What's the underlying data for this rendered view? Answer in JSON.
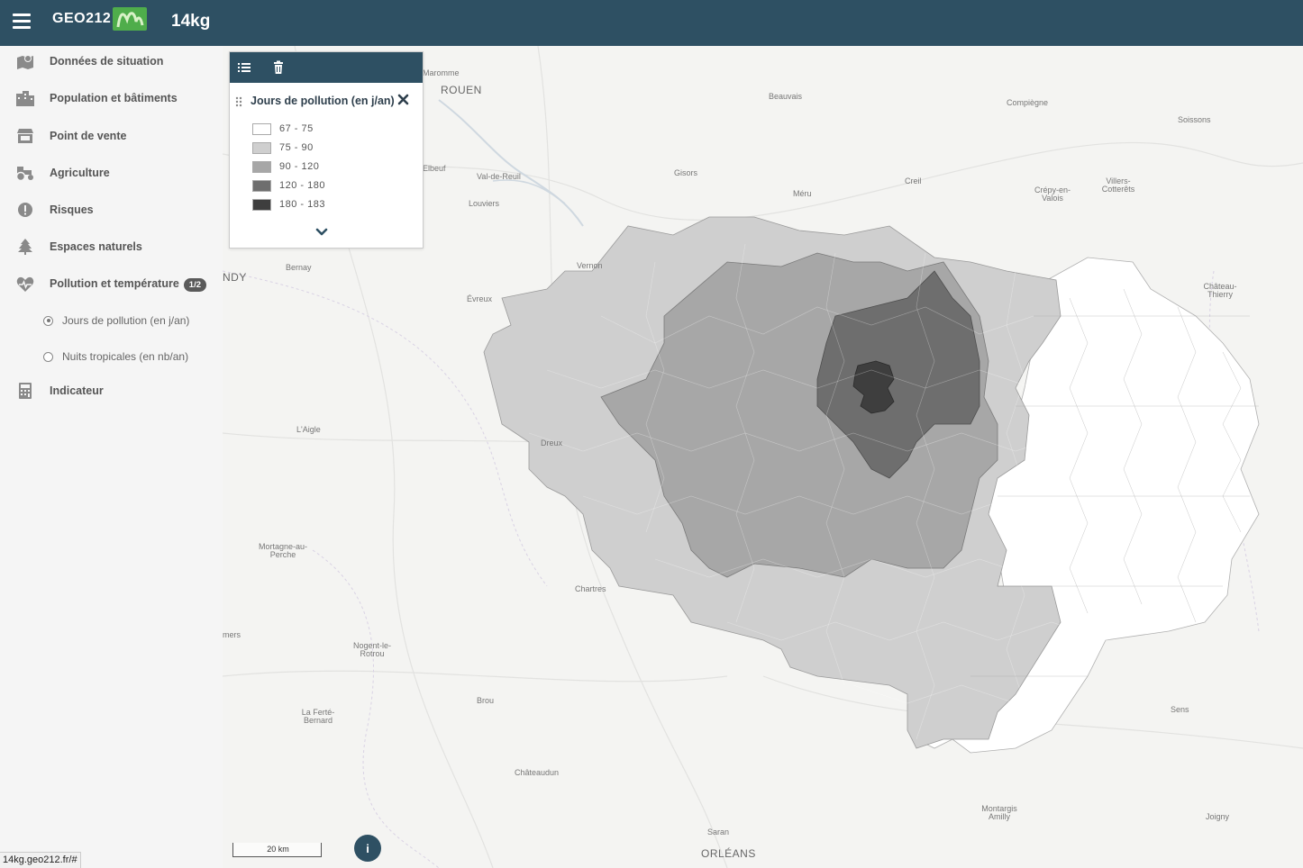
{
  "header": {
    "app_title": "14kg",
    "logo_text": "GEO212"
  },
  "sidebar": {
    "items": [
      {
        "label": "Données de situation",
        "icon": "map-marker-icon"
      },
      {
        "label": "Population et bâtiments",
        "icon": "buildings-icon"
      },
      {
        "label": "Point de vente",
        "icon": "store-icon"
      },
      {
        "label": "Agriculture",
        "icon": "tractor-icon"
      },
      {
        "label": "Risques",
        "icon": "exclamation-icon"
      },
      {
        "label": "Espaces naturels",
        "icon": "tree-icon"
      },
      {
        "label": "Pollution et température",
        "icon": "heartbeat-icon",
        "badge": "1/2"
      },
      {
        "label": "Indicateur",
        "icon": "calculator-icon"
      }
    ],
    "subitems": [
      {
        "label": "Jours de pollution (en j/an)",
        "selected": true
      },
      {
        "label": "Nuits tropicales (en nb/an)",
        "selected": false
      }
    ]
  },
  "legend": {
    "title": "Jours de pollution (en j/an)",
    "classes": [
      {
        "label": "67 - 75",
        "color": "#ffffff"
      },
      {
        "label": "75 - 90",
        "color": "#cfcfcf"
      },
      {
        "label": "90 - 120",
        "color": "#a7a7a7"
      },
      {
        "label": "120 - 180",
        "color": "#6e6e6e"
      },
      {
        "label": "180 - 183",
        "color": "#3e3e3e"
      }
    ]
  },
  "map": {
    "places": [
      "Maromme",
      "ROUEN",
      "Beauvais",
      "Compiègne",
      "Soissons",
      "Elbeuf",
      "Val-de-Reuil",
      "Gisors",
      "Louviers",
      "Méru",
      "Creil",
      "Crépy-en-Valois",
      "Villers-Cotterêts",
      "Vernon",
      "Bernay",
      "NDY",
      "Évreux",
      "Château-Thierry",
      "L'Aigle",
      "Dreux",
      "Mortagne-au-Perche",
      "Chartres",
      "Nogent-le-Rotrou",
      "mers",
      "La Ferté-Bernard",
      "Brou",
      "Châteaudun",
      "Sens",
      "Montargis Amilly",
      "Saran",
      "Joigny",
      "ORLÉANS"
    ],
    "scale_label": "20 km",
    "info_label": "i"
  },
  "status_bar": {
    "url": "14kg.geo212.fr/#"
  }
}
